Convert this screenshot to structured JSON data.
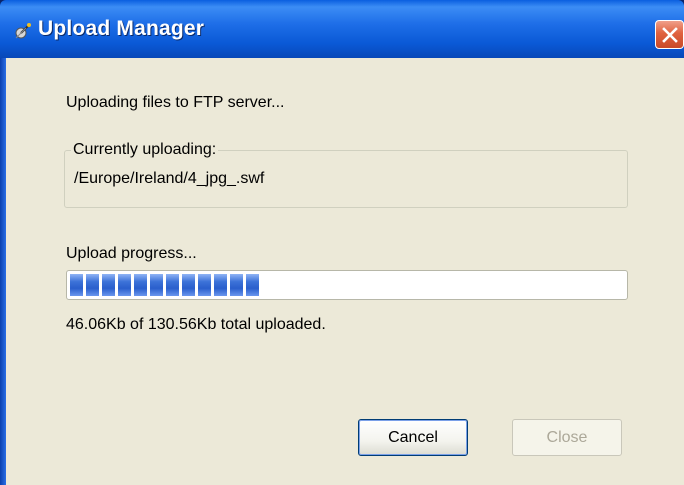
{
  "window": {
    "title": "Upload Manager"
  },
  "status": {
    "message": "Uploading files to FTP server..."
  },
  "current": {
    "legend": "Currently uploading:",
    "path": "/Europe/Ireland/4_jpg_.swf"
  },
  "progress": {
    "label": "Upload progress...",
    "fraction": 0.353,
    "summary": "46.06Kb of 130.56Kb total uploaded."
  },
  "buttons": {
    "cancel": "Cancel",
    "close": "Close"
  },
  "colors": {
    "titlebar": "#0a59d6",
    "progress_fill": "#2a5fcc",
    "dialog_bg": "#ece9d8"
  },
  "icons": {
    "title": "satellite-dish-icon",
    "close": "close-icon"
  }
}
